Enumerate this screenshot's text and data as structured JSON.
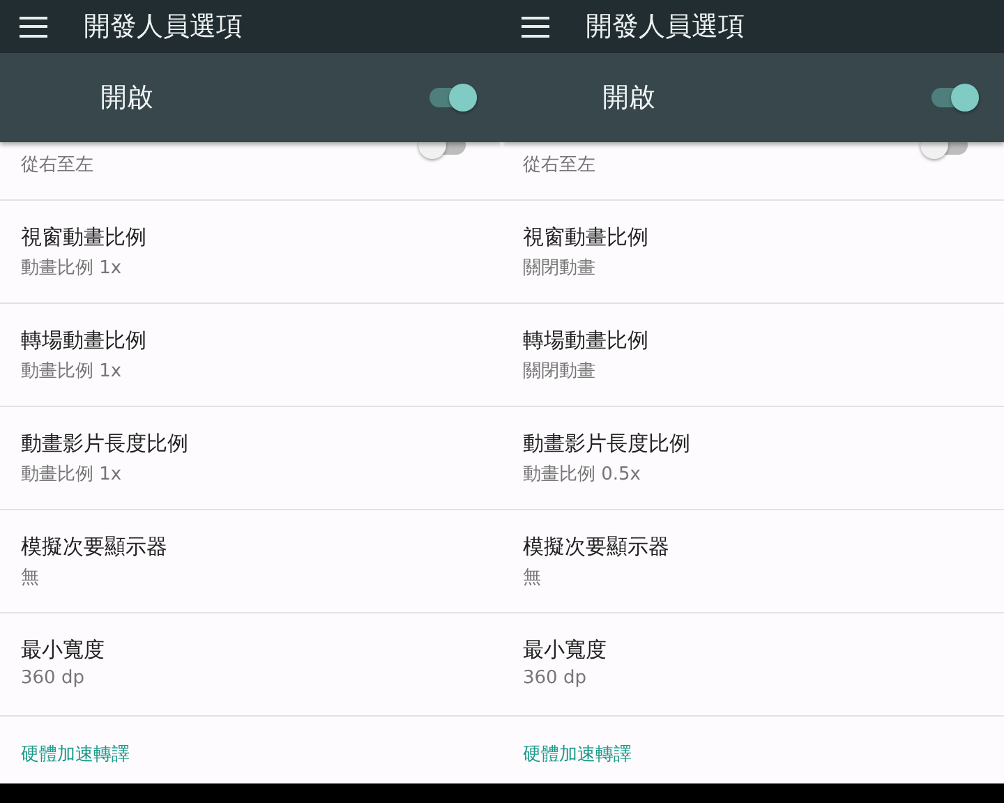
{
  "panels": [
    {
      "toolbar": {
        "title": "開發人員選項"
      },
      "master_switch": {
        "label": "開啟",
        "on": true
      },
      "partial_row": {
        "summary": "從右至左",
        "on": false
      },
      "rows": [
        {
          "title": "視窗動畫比例",
          "summary": "動畫比例 1x"
        },
        {
          "title": "轉場動畫比例",
          "summary": "動畫比例 1x"
        },
        {
          "title": "動畫影片長度比例",
          "summary": "動畫比例 1x"
        },
        {
          "title": "模擬次要顯示器",
          "summary": "無"
        },
        {
          "title": "最小寬度",
          "summary": "360 dp"
        }
      ],
      "category": "硬體加速轉譯"
    },
    {
      "toolbar": {
        "title": "開發人員選項"
      },
      "master_switch": {
        "label": "開啟",
        "on": true
      },
      "partial_row": {
        "summary": "從右至左",
        "on": false
      },
      "rows": [
        {
          "title": "視窗動畫比例",
          "summary": "關閉動畫"
        },
        {
          "title": "轉場動畫比例",
          "summary": "關閉動畫"
        },
        {
          "title": "動畫影片長度比例",
          "summary": "動畫比例 0.5x"
        },
        {
          "title": "模擬次要顯示器",
          "summary": "無"
        },
        {
          "title": "最小寬度",
          "summary": "360 dp"
        }
      ],
      "category": "硬體加速轉譯"
    }
  ]
}
